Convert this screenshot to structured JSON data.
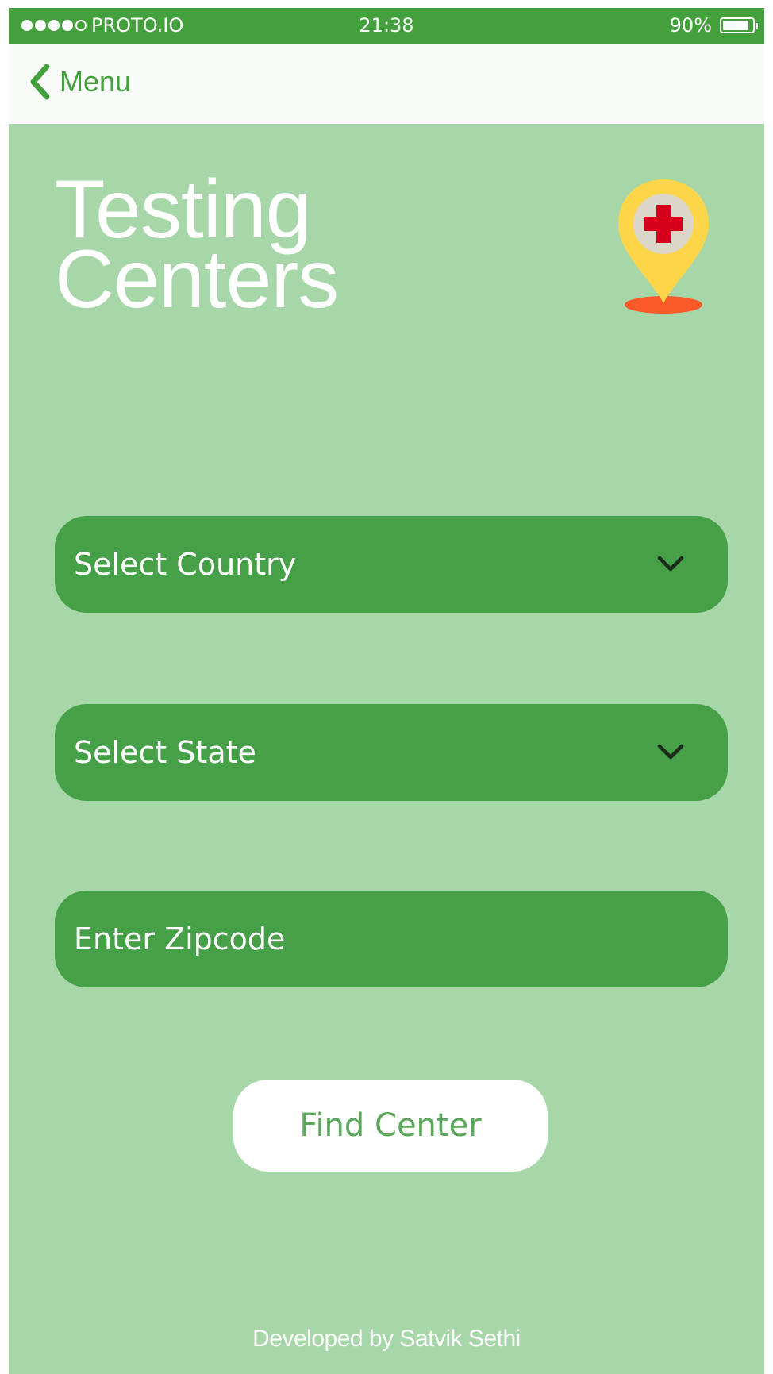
{
  "status_bar": {
    "carrier": "PROTO.IO",
    "time": "21:38",
    "battery": "90%",
    "battery_level": 0.9,
    "signal_bars_filled": 4,
    "signal_bars_total": 5
  },
  "nav": {
    "back_label": "Menu",
    "back_icon": "chevron-left-icon"
  },
  "header": {
    "title_line1": "Testing",
    "title_line2": "Centers",
    "icon": "map-pin-medical-icon"
  },
  "form": {
    "country": {
      "label": "Select Country",
      "icon": "chevron-down-icon"
    },
    "state": {
      "label": "Select State",
      "icon": "chevron-down-icon"
    },
    "zipcode": {
      "value": "",
      "placeholder": "Enter Zipcode"
    },
    "submit_label": "Find Center"
  },
  "footer": {
    "credit": "Developed by Satvik Sethi"
  },
  "colors": {
    "status_bar": "#43a03c",
    "background": "#a7d6a8",
    "field": "#45a048",
    "nav_bar": "#f8fbf8",
    "accent_text": "#43a03c",
    "pin_yellow": "#fcd549",
    "pin_base": "#f95a28",
    "cross_red": "#d6001c"
  }
}
